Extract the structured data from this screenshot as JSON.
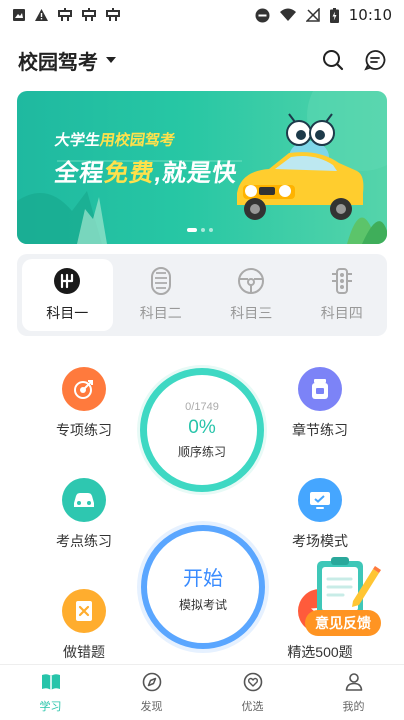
{
  "status_bar": {
    "time": "10:10"
  },
  "header": {
    "title": "校园驾考"
  },
  "banner": {
    "line1_white_a": "大学生",
    "line1_yellow": "用校园驾考",
    "line2_white_a": "全程",
    "line2_yellow": "免费",
    "line2_white_b": ",就是快"
  },
  "subjects": [
    {
      "label": "科目一"
    },
    {
      "label": "科目二"
    },
    {
      "label": "科目三"
    },
    {
      "label": "科目四"
    }
  ],
  "practice": {
    "special": "专项练习",
    "chapter": "章节练习",
    "points": "考点练习",
    "exam_mode": "考场模式",
    "mistakes": "做错题",
    "featured": "精选500题",
    "sequential": {
      "count": "0/1749",
      "percent": "0%",
      "label": "顺序练习"
    },
    "start": {
      "label": "开始",
      "sublabel": "模拟考试"
    }
  },
  "feedback": {
    "label": "意见反馈"
  },
  "bottom_nav": [
    {
      "label": "学习"
    },
    {
      "label": "发现"
    },
    {
      "label": "优选"
    },
    {
      "label": "我的"
    }
  ],
  "colors": {
    "accent": "#27c4aa",
    "orange": "#ff7a3d",
    "purple": "#7c83f7",
    "teal": "#2ec7b0",
    "blue": "#45a6ff",
    "feedback": "#ff9422"
  }
}
